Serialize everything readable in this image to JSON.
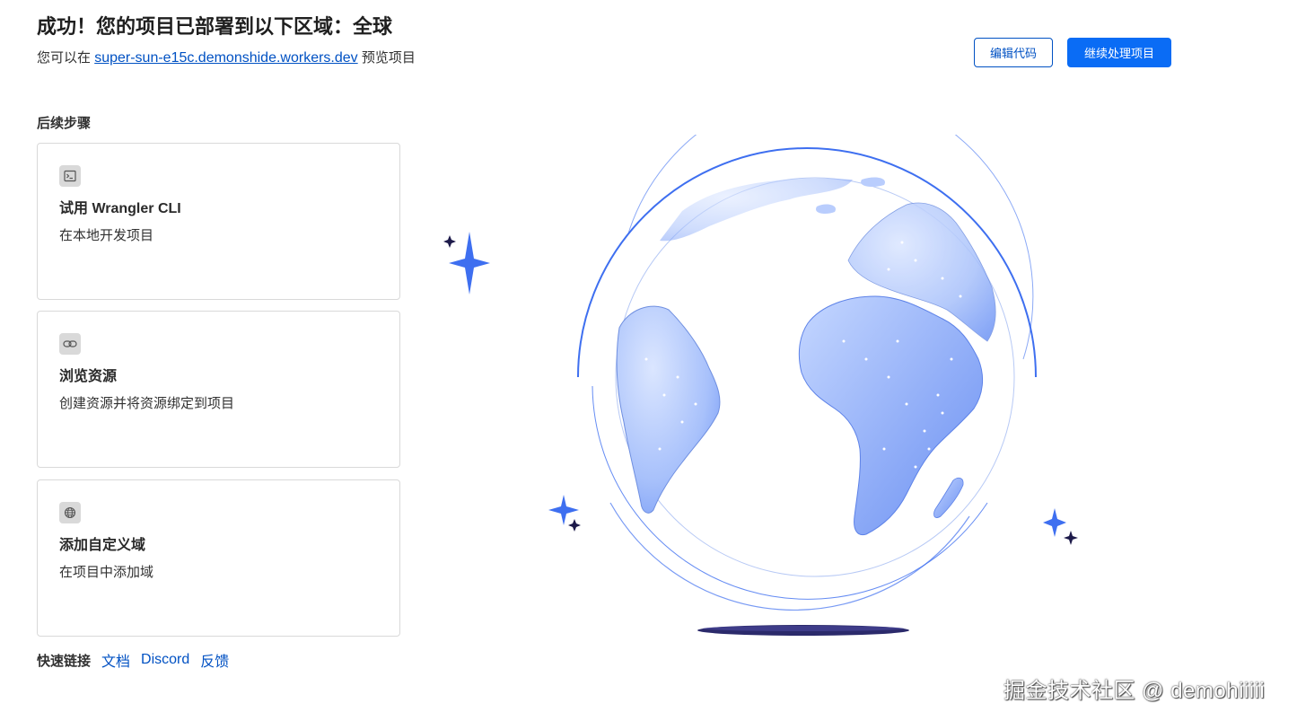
{
  "header": {
    "title": "成功！您的项目已部署到以下区域：全球",
    "preview_prefix": "您可以在",
    "preview_url": "super-sun-e15c.demonshide.workers.dev",
    "preview_suffix": "预览项目"
  },
  "actions": {
    "edit_code": "编辑代码",
    "continue": "继续处理项目"
  },
  "next_steps": {
    "heading": "后续步骤",
    "cards": [
      {
        "icon": "terminal-icon",
        "title": "试用 Wrangler CLI",
        "description": "在本地开发项目"
      },
      {
        "icon": "link-icon",
        "title": "浏览资源",
        "description": "创建资源并将资源绑定到项目"
      },
      {
        "icon": "globe-icon",
        "title": "添加自定义域",
        "description": "在项目中添加域"
      }
    ]
  },
  "quick_links": {
    "label": "快速链接",
    "links": [
      "文档",
      "Discord",
      "反馈"
    ]
  },
  "watermark": "掘金技术社区 @ demohiiiii",
  "colors": {
    "accent": "#0a6cf5",
    "link": "#0051c3",
    "globe_light": "#c9daff",
    "globe_dark": "#6f95f5",
    "sparkle": "#3e6ff0",
    "shadow": "#2b2a6b"
  }
}
